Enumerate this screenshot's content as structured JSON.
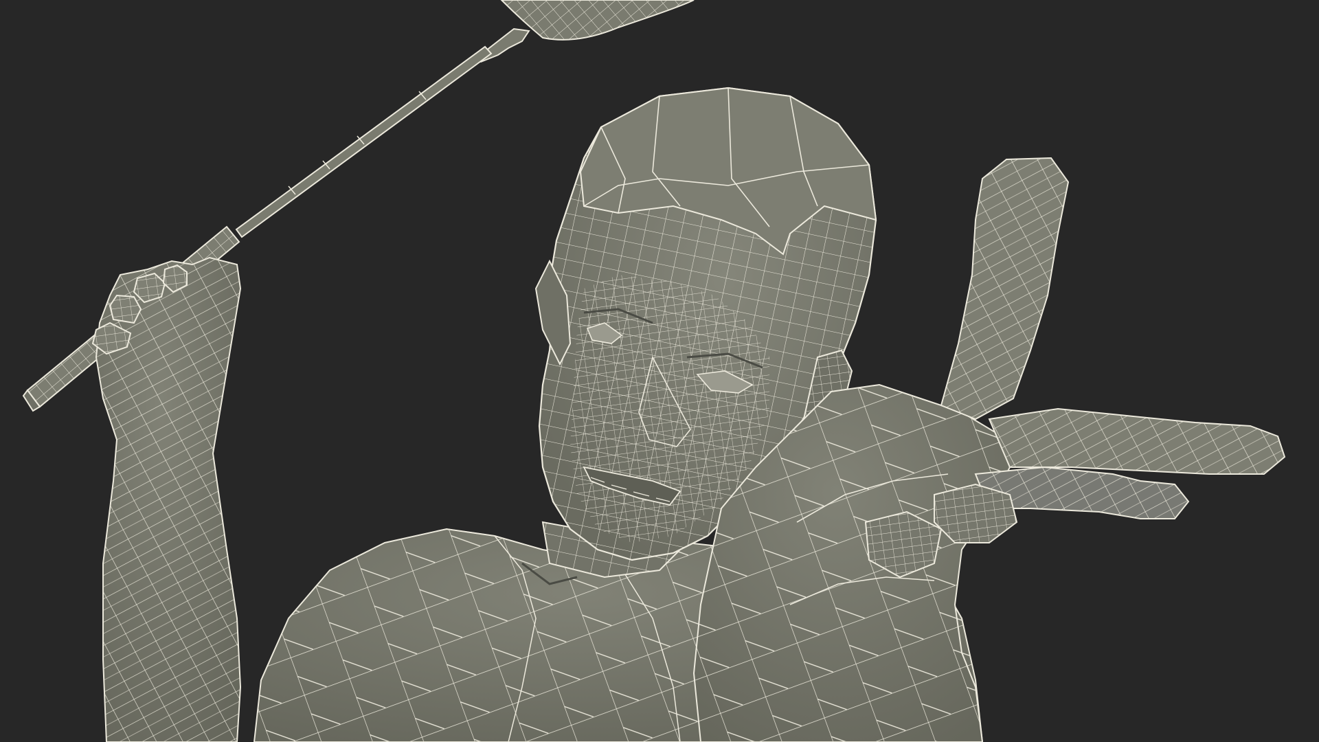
{
  "scene": {
    "subject": "wireframe-3d-badminton-player",
    "colors": {
      "background": "#272727",
      "surface": "#7a7b6f",
      "surface_shadow": "#66675c",
      "surface_highlight": "#8b8c80",
      "wire": "#ece9dc",
      "crease": "#4a4b44"
    },
    "objects": [
      {
        "name": "badminton-racket",
        "kind": "mesh"
      },
      {
        "name": "raised-right-hand",
        "kind": "mesh"
      },
      {
        "name": "head",
        "kind": "mesh"
      },
      {
        "name": "torso",
        "kind": "mesh"
      },
      {
        "name": "extended-left-hand",
        "kind": "mesh"
      }
    ]
  }
}
